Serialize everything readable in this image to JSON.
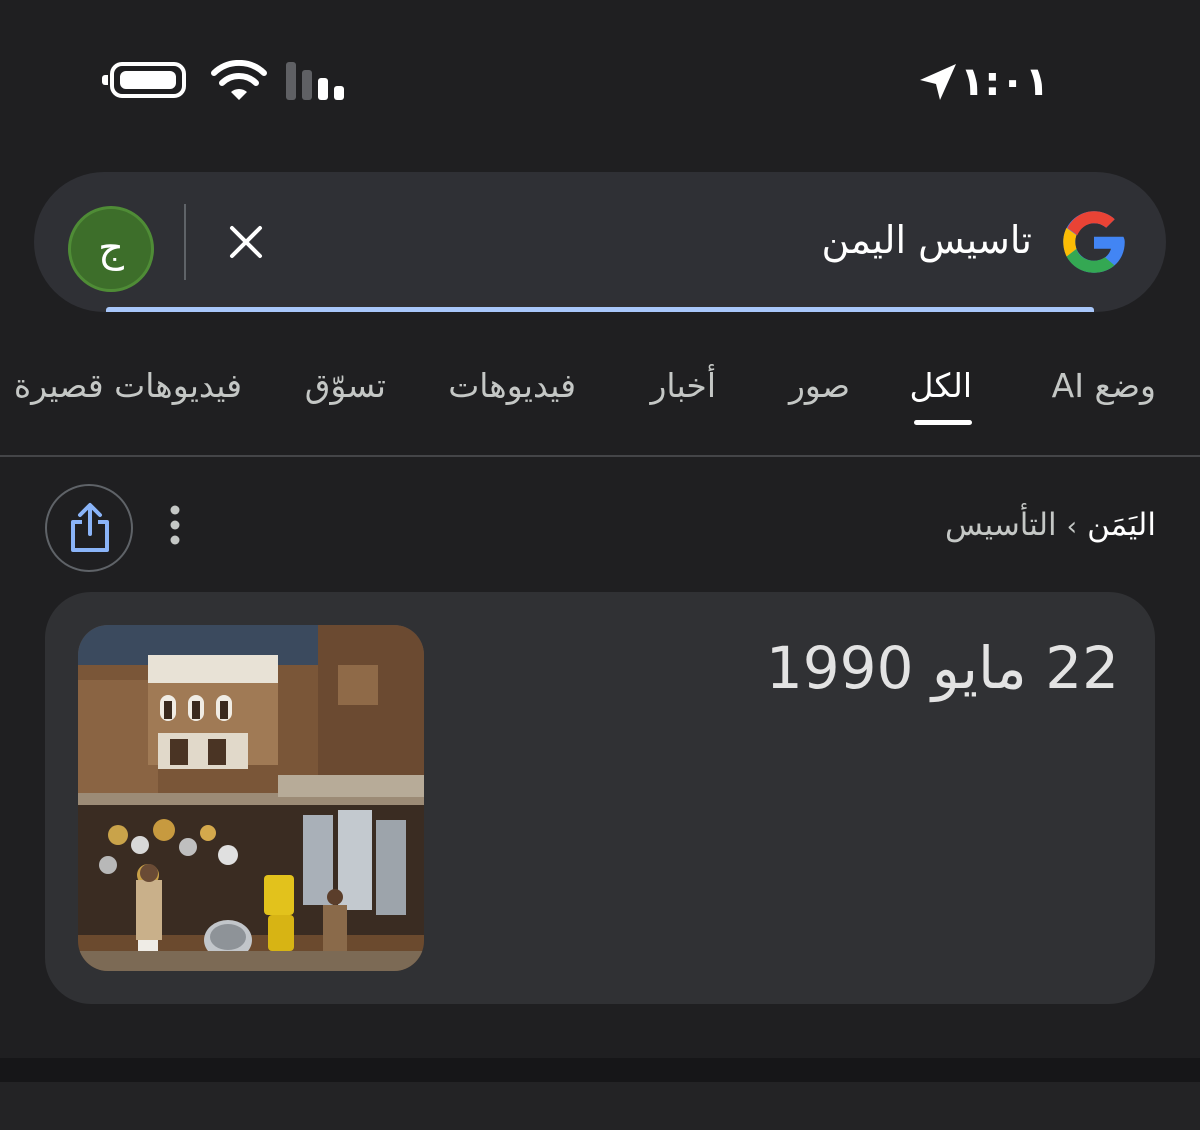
{
  "status_bar": {
    "time": "١:٠١"
  },
  "search": {
    "query": "تاسيس اليمن",
    "avatar_letter": "ج"
  },
  "tabs": [
    {
      "label": "وضع AI"
    },
    {
      "label": "الكل"
    },
    {
      "label": "صور"
    },
    {
      "label": "أخبار"
    },
    {
      "label": "فيديوهات"
    },
    {
      "label": "تسوّق"
    },
    {
      "label": "فيديوهات قصيرة"
    }
  ],
  "active_tab": "الكل",
  "result": {
    "breadcrumb": {
      "entity": "اليَمَن",
      "separator": "›",
      "attribute": "التأسيس"
    },
    "answer": "22 مايو 1990"
  },
  "colors": {
    "background": "#1f1f21",
    "search_bar": "#2f3035",
    "card": "#303134",
    "accent_underline": "#a8c7fa",
    "avatar": "#3d6e2a"
  },
  "icons": [
    "battery-icon",
    "wifi-icon",
    "signal-icon",
    "location-icon",
    "clear-icon",
    "google-logo-icon",
    "share-icon",
    "more-vert-icon"
  ]
}
